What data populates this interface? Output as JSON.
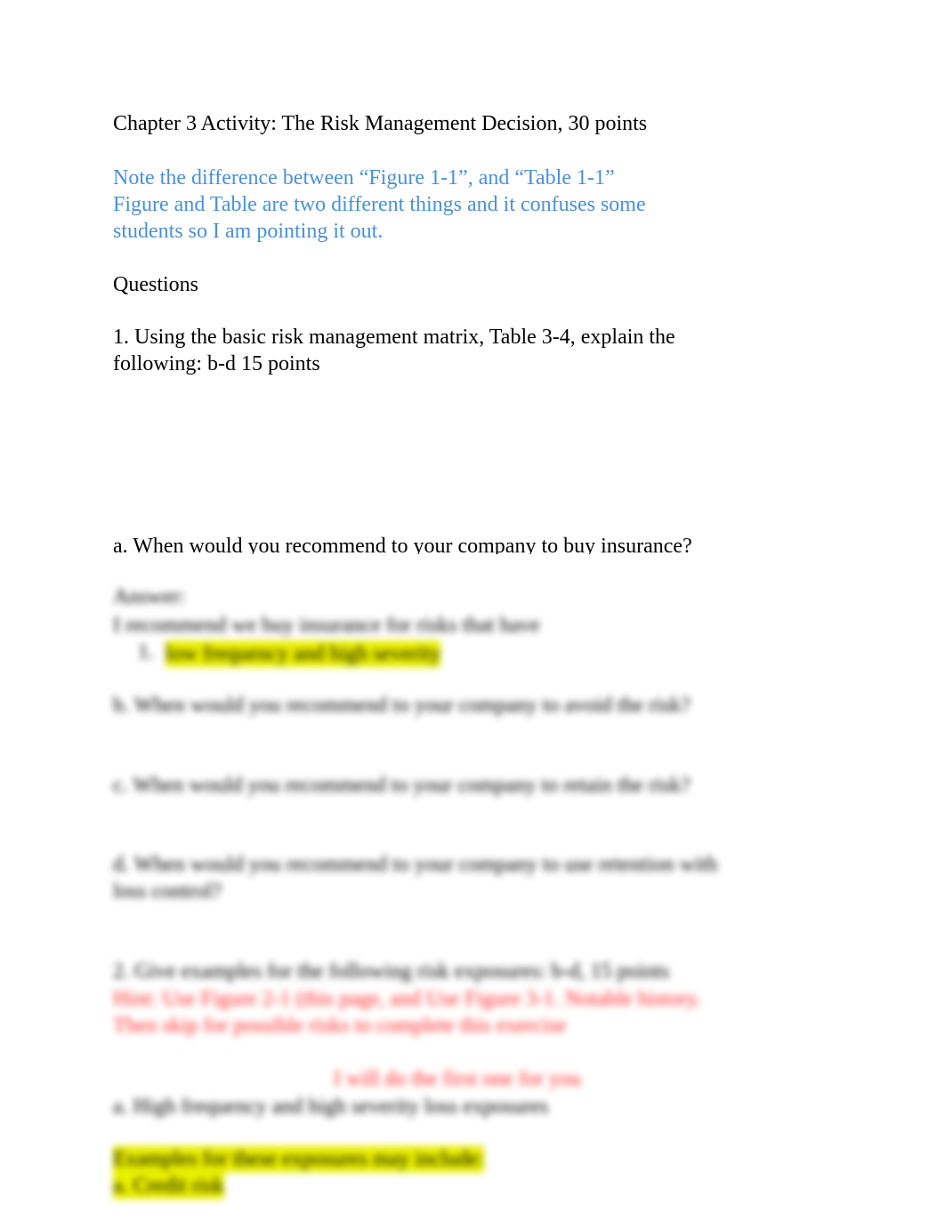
{
  "title": "Chapter 3 Activity:    The Risk Management Decision, 30 points",
  "note": [
    "Note the difference between “Figure 1-1”, and “Table 1-1”",
    "Figure and Table are two different things and it confuses some",
    "students so I am pointing it out."
  ],
  "questions_heading": "Questions",
  "q1": [
    "1. Using the basic risk management matrix, Table 3-4, explain the",
    "following:  b-d 15 points"
  ],
  "qa": "a. When would you recommend to your company to buy insurance?",
  "blurred": {
    "answer_label": "Answer:",
    "answer_line": "I recommend we buy insurance for risks that have",
    "answer_bullet": "1.",
    "answer_highlight": "low frequency and high severity",
    "qb": "b. When would you recommend to your company to avoid the risk?",
    "qc": "c. When would you recommend to your company to retain the risk?",
    "qd": [
      "d. When would you recommend to your company to use retention with",
      "loss control?"
    ],
    "q2": "2. Give examples for the following risk exposures: b-d, 15 points",
    "hint": [
      "Hint:  Use Figure 2-1 (this page, and Use Figure 3-1. Notable history.",
      "Then skip for possible risks to complete this exercise"
    ],
    "first_one": "I will do the first one for you",
    "q2a": "a. High frequency and high severity loss exposures",
    "examples": [
      "Examples for these exposures may include:",
      "a. Credit risk"
    ]
  },
  "colors": {
    "note": "#4a90d9",
    "hint": "#ff2020",
    "highlight": "#eaf000"
  }
}
